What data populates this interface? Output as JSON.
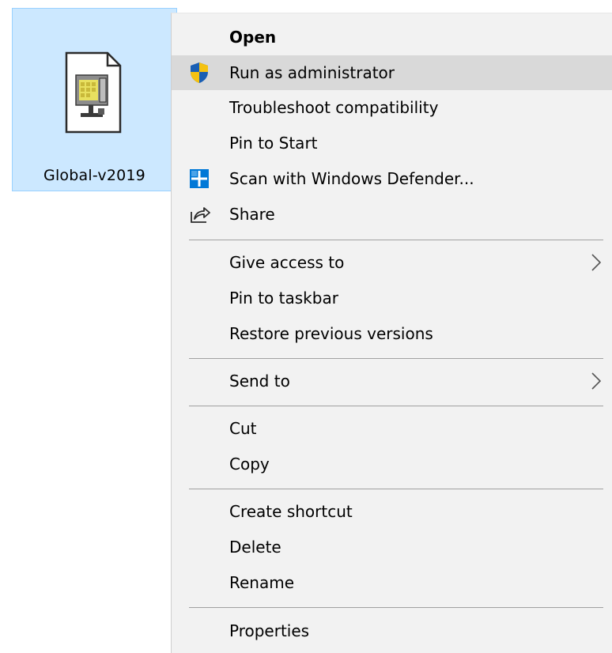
{
  "desktop_file": {
    "name": "Global-v2019",
    "icon": "application-file-icon"
  },
  "context_menu": {
    "items": {
      "open": {
        "label": "Open"
      },
      "run_as_admin": {
        "label": "Run as administrator",
        "icon": "uac-shield-icon"
      },
      "troubleshoot": {
        "label": "Troubleshoot compatibility"
      },
      "pin_start": {
        "label": "Pin to Start"
      },
      "scan_defender": {
        "label": "Scan with Windows Defender...",
        "icon": "windows-defender-icon"
      },
      "share": {
        "label": "Share",
        "icon": "share-icon"
      },
      "give_access": {
        "label": "Give access to",
        "submenu": true
      },
      "pin_taskbar": {
        "label": "Pin to taskbar"
      },
      "restore_versions": {
        "label": "Restore previous versions"
      },
      "send_to": {
        "label": "Send to",
        "submenu": true
      },
      "cut": {
        "label": "Cut"
      },
      "copy": {
        "label": "Copy"
      },
      "create_shortcut": {
        "label": "Create shortcut"
      },
      "delete": {
        "label": "Delete"
      },
      "rename": {
        "label": "Rename"
      },
      "properties": {
        "label": "Properties"
      }
    }
  },
  "colors": {
    "selection_fill": "#cce8ff",
    "selection_border": "#99d1ff",
    "menu_background": "#f2f2f2",
    "hover_highlight": "#d9d9d9",
    "separator": "#a0a0a0",
    "shield_blue": "#1a5fb4",
    "shield_yellow": "#f5c211",
    "defender_blue": "#0078d7"
  }
}
